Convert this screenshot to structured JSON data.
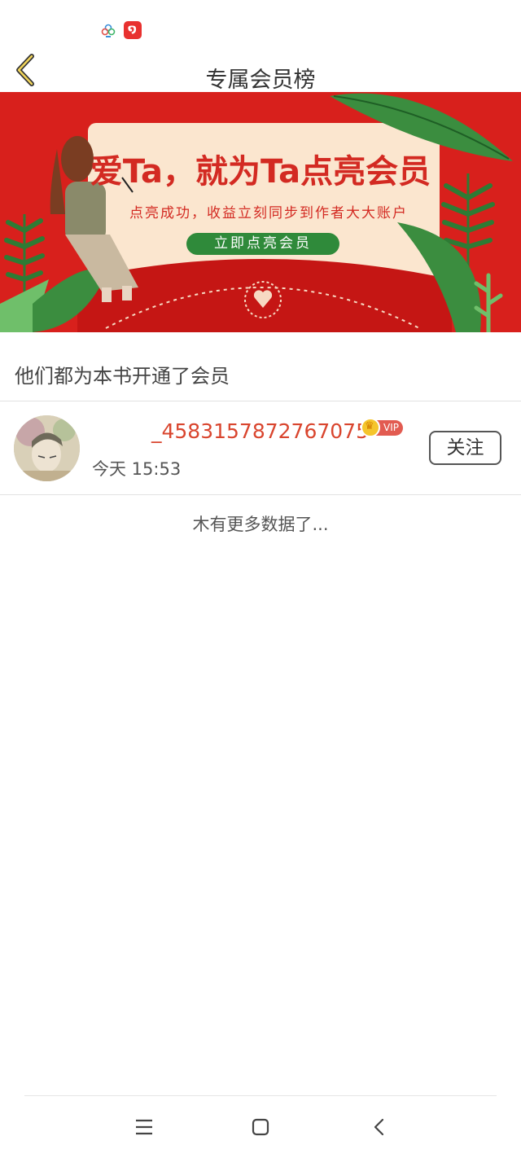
{
  "status_bar": {
    "icons": [
      "clover-app-icon",
      "netease-music-icon"
    ]
  },
  "header": {
    "title": "专属会员榜",
    "back_icon": "chevron-left-icon"
  },
  "banner": {
    "headline": "爱Ta，就为Ta点亮会员",
    "subtitle": "点亮成功，收益立刻同步到作者大大账户",
    "cta": "立即点亮会员",
    "colors": {
      "background": "#d8201c",
      "card": "#fbe6cf",
      "accent_green": "#2f8a3a"
    }
  },
  "section": {
    "title": "他们都为本书开通了会员"
  },
  "members": [
    {
      "username": "_4583157872767075",
      "badge": "VIP",
      "time": "今天 15:53",
      "follow_label": "关注"
    }
  ],
  "footer": {
    "no_more": "木有更多数据了..."
  },
  "nav": {
    "icons": [
      "menu-icon",
      "home-square-icon",
      "back-arrow-icon"
    ]
  }
}
